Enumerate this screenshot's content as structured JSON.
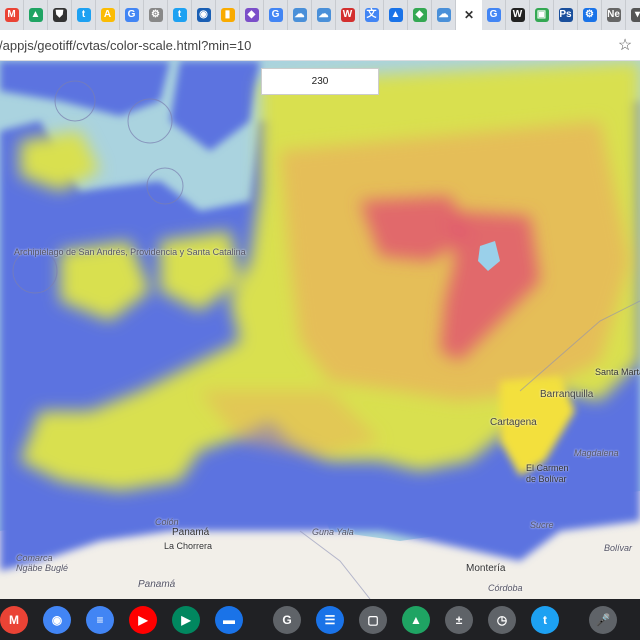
{
  "tabs": [
    {
      "icon": "gmail-icon",
      "color": "#ea4335",
      "glyph": "M"
    },
    {
      "icon": "drive-icon",
      "color": "#1fa463",
      "glyph": "▲"
    },
    {
      "icon": "shield-icon",
      "color": "#333333",
      "glyph": "⛊"
    },
    {
      "icon": "twitter-icon",
      "color": "#1da1f2",
      "glyph": "t"
    },
    {
      "icon": "ads-icon",
      "color": "#fbbc04",
      "glyph": "A"
    },
    {
      "icon": "google-icon",
      "color": "#4285f4",
      "glyph": "G"
    },
    {
      "icon": "gear-icon",
      "color": "#888888",
      "glyph": "⚙"
    },
    {
      "icon": "twitter-icon",
      "color": "#1da1f2",
      "glyph": "t"
    },
    {
      "icon": "noaa-icon",
      "color": "#1a5fb4",
      "glyph": "◉"
    },
    {
      "icon": "analytics-icon",
      "color": "#f9ab00",
      "glyph": "▮"
    },
    {
      "icon": "cube-icon",
      "color": "#7b4fc9",
      "glyph": "◆"
    },
    {
      "icon": "google-icon",
      "color": "#4285f4",
      "glyph": "G"
    },
    {
      "icon": "cloud-icon",
      "color": "#4a90d9",
      "glyph": "☁"
    },
    {
      "icon": "cloud-icon",
      "color": "#4a90d9",
      "glyph": "☁"
    },
    {
      "icon": "wordpress-icon",
      "color": "#d32f2f",
      "glyph": "W"
    },
    {
      "icon": "translate-icon",
      "color": "#4285f4",
      "glyph": "文"
    },
    {
      "icon": "triangle-icon",
      "color": "#1a73e8",
      "glyph": "▲"
    },
    {
      "icon": "maps-icon",
      "color": "#34a853",
      "glyph": "◆"
    },
    {
      "icon": "cloud-icon",
      "color": "#4a90d9",
      "glyph": "☁"
    },
    {
      "icon": "close-icon",
      "color": "#333333",
      "glyph": "✕",
      "active": true
    },
    {
      "icon": "google-icon",
      "color": "#4285f4",
      "glyph": "G"
    },
    {
      "icon": "wikipedia-icon",
      "color": "#222222",
      "glyph": "W"
    },
    {
      "icon": "image-icon",
      "color": "#34a853",
      "glyph": "▣"
    },
    {
      "icon": "photoshop-icon",
      "color": "#1a4f9c",
      "glyph": "Ps"
    },
    {
      "icon": "gear-icon",
      "color": "#1a73e8",
      "glyph": "⚙"
    },
    {
      "icon": "news-icon",
      "color": "#666666",
      "glyph": "Ne"
    },
    {
      "icon": "dropdown-icon",
      "color": "#555555",
      "glyph": "▾"
    }
  ],
  "address": {
    "url": "/appjs/geotiff/cvtas/color-scale.html?min=10"
  },
  "value_box": {
    "text": "230"
  },
  "map_labels": {
    "archipelago": "Archipiélago de San Andrés, Providencia y Santa Catalina",
    "cartagena": "Cartagena",
    "barranquilla": "Barranquilla",
    "santa_marta": "Santa Marta",
    "el_carmen": "El Carmen de Bolívar",
    "magdalena": "Magdalena",
    "sucre": "Sucre",
    "monteria": "Montería",
    "cordoba": "Córdoba",
    "bolivar": "Bolívar",
    "panama": "Panamá",
    "la_chorrera": "La Chorrera",
    "colon": "Colón",
    "panama_region": "Panamá",
    "guna_yala": "Guna Yala",
    "comarca": "Comarca Ngäbe Buglé"
  },
  "shelf_apps": [
    {
      "icon": "gmail-icon",
      "color": "#ea4335",
      "glyph": "M"
    },
    {
      "icon": "chrome-icon",
      "color": "#4285f4",
      "glyph": "◉"
    },
    {
      "icon": "docs-icon",
      "color": "#4285f4",
      "glyph": "≡"
    },
    {
      "icon": "youtube-icon",
      "color": "#ff0000",
      "glyph": "▶"
    },
    {
      "icon": "play-store-icon",
      "color": "#01875f",
      "glyph": "▶"
    },
    {
      "icon": "files-icon",
      "color": "#1a73e8",
      "glyph": "▬"
    },
    {
      "icon": "g-app-icon",
      "color": "#5f6368",
      "glyph": "G"
    },
    {
      "icon": "messages-icon",
      "color": "#1a73e8",
      "glyph": "☰"
    },
    {
      "icon": "screenshot-icon",
      "color": "#5f6368",
      "glyph": "▢"
    },
    {
      "icon": "drive-icon",
      "color": "#1fa463",
      "glyph": "▲"
    },
    {
      "icon": "calculator-icon",
      "color": "#5f6368",
      "glyph": "±"
    },
    {
      "icon": "clock-icon",
      "color": "#5f6368",
      "glyph": "◷"
    },
    {
      "icon": "twitter-icon",
      "color": "#1da1f2",
      "glyph": "t"
    },
    {
      "icon": "microphone-icon",
      "color": "#5f6368",
      "glyph": "🎤"
    }
  ]
}
